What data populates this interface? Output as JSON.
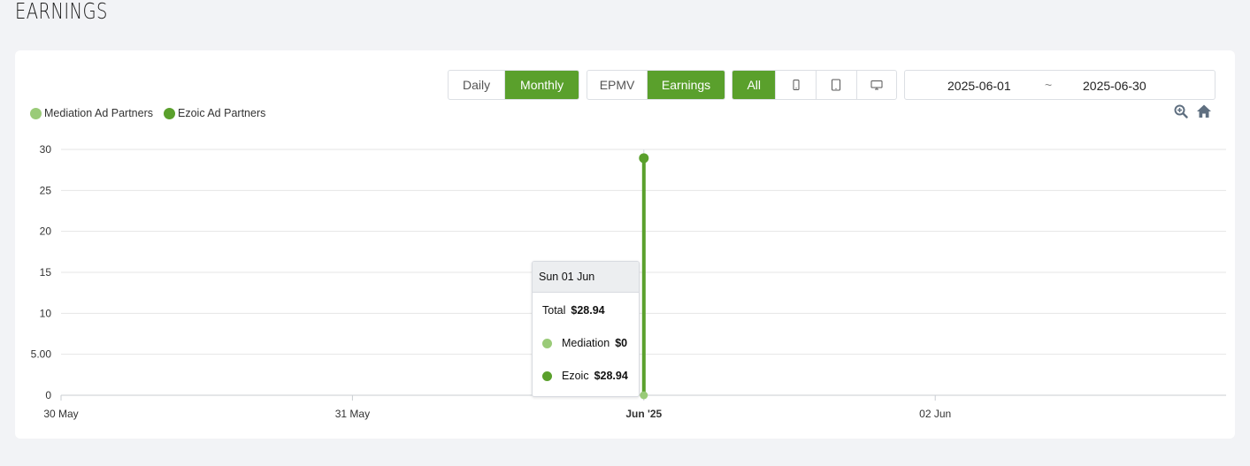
{
  "page": {
    "title": "EARNINGS"
  },
  "toolbar": {
    "period": {
      "daily": "Daily",
      "monthly": "Monthly",
      "active": "monthly"
    },
    "metric": {
      "epmv": "EPMV",
      "earnings": "Earnings",
      "active": "earnings"
    },
    "device": {
      "all": "All",
      "icons": [
        "mobile-icon",
        "tablet-icon",
        "desktop-icon"
      ],
      "active": "all"
    },
    "date_range": {
      "start": "2025-06-01",
      "separator": "~",
      "end": "2025-06-30"
    },
    "tools": [
      "zoom-in-icon",
      "home-icon"
    ]
  },
  "colors": {
    "accent": "#5aa02c",
    "mediation": "#9acb78",
    "ezoic": "#5aa02c"
  },
  "chart_data": {
    "type": "line",
    "x_tick_labels": [
      "30 May",
      "31 May",
      "Jun '25",
      "02 Jun"
    ],
    "y_tick_labels": [
      "0",
      "5.00",
      "10",
      "15",
      "20",
      "25",
      "30"
    ],
    "ylim": [
      0,
      30
    ],
    "grid": true,
    "legend_position": "top-left",
    "series": [
      {
        "name": "Mediation Ad Partners",
        "color": "#9acb78",
        "points": [
          {
            "x": "2025-06-01",
            "y": 0
          }
        ]
      },
      {
        "name": "Ezoic Ad Partners",
        "color": "#5aa02c",
        "points": [
          {
            "x": "2025-06-01",
            "y": 28.94
          }
        ]
      }
    ]
  },
  "tooltip": {
    "date": "Sun 01 Jun",
    "total_label": "Total",
    "total_value": "$28.94",
    "rows": [
      {
        "label": "Mediation",
        "value": "$0",
        "color": "#9acb78"
      },
      {
        "label": "Ezoic",
        "value": "$28.94",
        "color": "#5aa02c"
      }
    ]
  }
}
